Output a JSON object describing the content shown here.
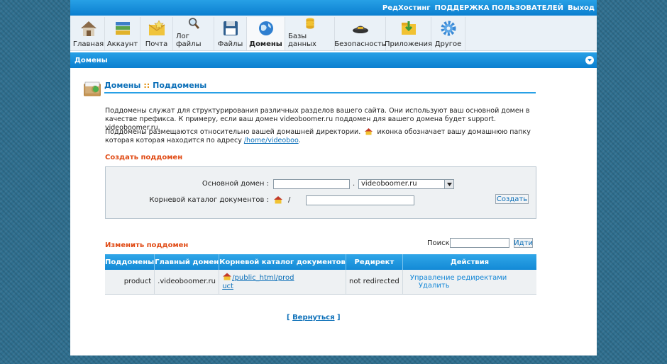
{
  "header": {
    "brand": "РедХостинг",
    "support": "ПОДДЕРЖКА ПОЛЬЗОВАТЕЛЕЙ",
    "logout": "Выход"
  },
  "toolbar": {
    "items": [
      {
        "label": "Главная",
        "icon": "house-icon"
      },
      {
        "label": "Аккаунт",
        "icon": "books-icon"
      },
      {
        "label": "Почта",
        "icon": "mail-icon"
      },
      {
        "label": "Лог файлы",
        "icon": "magnifier-icon"
      },
      {
        "label": "Файлы",
        "icon": "floppy-icon"
      },
      {
        "label": "Домены",
        "icon": "globe-icon"
      },
      {
        "label": "Базы данных",
        "icon": "database-icon"
      },
      {
        "label": "Безопасность",
        "icon": "security-cap-icon"
      },
      {
        "label": "Приложения",
        "icon": "apps-folder-icon"
      },
      {
        "label": "Другое",
        "icon": "gear-icon"
      }
    ],
    "active": "Домены"
  },
  "section": {
    "title": "Домены"
  },
  "page": {
    "breadcrumb_parent": "Домены",
    "breadcrumb_separator": "::",
    "breadcrumb_current": "Поддомены",
    "intro_1": "Поддомены служат для структурирования различных разделов вашего сайта. Они используют ваш основной домен в качестве префикса. К примеру, если ваш домен videoboomer.ru поддомен для вашего домена будет support. videoboomer.ru.",
    "intro_2_before_icon": "Поддомены размещаются относительно вашей домашней директории.",
    "intro_2_after_icon": "иконка обозначает вашу домашнюю папку которая которая находится по адресу",
    "home_path": "/home/videoboo",
    "home_path_end": "."
  },
  "create": {
    "heading": "Создать поддомен",
    "domain_label": "Основной домен :",
    "subdomain_value": "",
    "dot": ".",
    "domain_selected": "videoboomer.ru",
    "docroot_label": "Корневой каталог документов :",
    "docroot_slash": "/",
    "docroot_value": "",
    "submit": "Создать"
  },
  "manage": {
    "heading": "Изменить поддомен",
    "search_label": "Поиск",
    "search_value": "",
    "search_button": "Идти",
    "columns": [
      "Поддомены",
      "Главный домен",
      "Корневой каталог документов",
      "Редирект",
      "Действия"
    ],
    "rows": [
      {
        "subdomain": "product",
        "main_domain": ".videoboomer.ru",
        "docroot_line1": "/public_html/prod",
        "docroot_line2": "uct",
        "redirect": "not redirected",
        "action_redirects": "Управление редиректами",
        "action_delete": "Удалить"
      }
    ]
  },
  "footer": {
    "back_open": "[",
    "back_label": "Вернуться",
    "back_close": "]"
  }
}
